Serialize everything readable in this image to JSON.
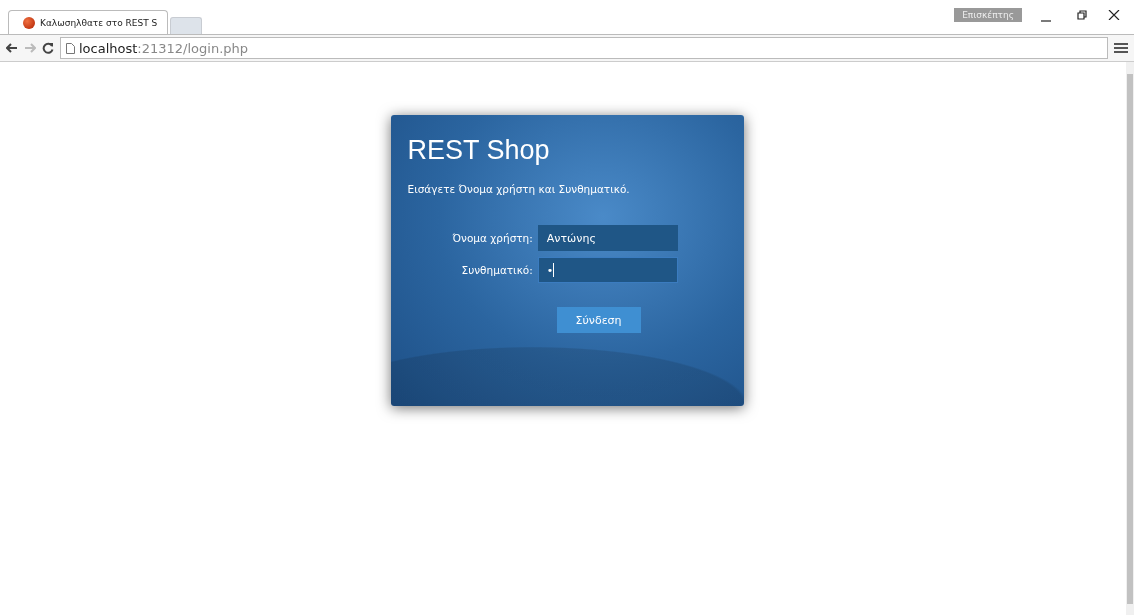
{
  "browser": {
    "tab": {
      "title": "Καλωσηλθατε στο REST S",
      "selected": true
    },
    "profile": "Επισκέπτης",
    "address": {
      "host": "localhost",
      "path": ":21312/login.php"
    }
  },
  "login": {
    "title": "REST Shop",
    "instructions": "Εισάγετε Όνομα χρήστη και Συνθηματικό.",
    "fields": [
      {
        "label": "Όνομα χρήστη:",
        "value": "Αντώνης",
        "focused": false
      },
      {
        "label": "Συνθηματικό:",
        "value": "•",
        "focused": true
      }
    ],
    "submit": "Σύνδεση"
  }
}
